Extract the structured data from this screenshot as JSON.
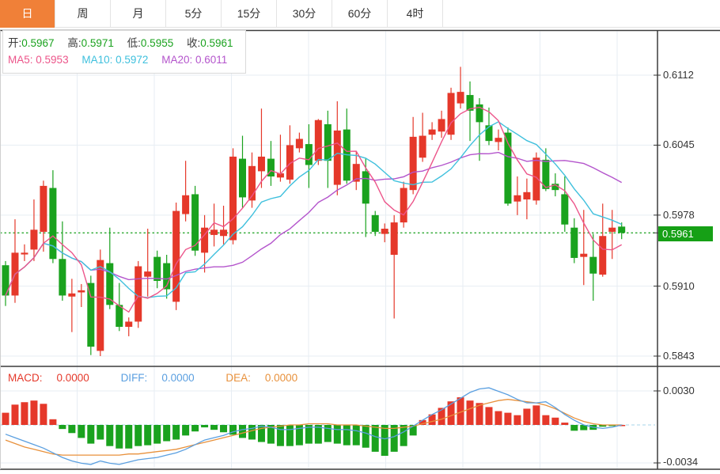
{
  "tabs": {
    "items": [
      {
        "label": "日",
        "active": true
      },
      {
        "label": "周",
        "active": false
      },
      {
        "label": "月",
        "active": false
      },
      {
        "label": "5分",
        "active": false
      },
      {
        "label": "15分",
        "active": false
      },
      {
        "label": "30分",
        "active": false
      },
      {
        "label": "60分",
        "active": false
      },
      {
        "label": "4时",
        "active": false
      }
    ]
  },
  "info_box": {
    "ohlc": [
      {
        "label": "开:",
        "value": "0.5967"
      },
      {
        "label": "高:",
        "value": "0.5971"
      },
      {
        "label": "低:",
        "value": "0.5955"
      },
      {
        "label": "收:",
        "value": "0.5961"
      }
    ],
    "ma": [
      {
        "label": "MA5:",
        "value": "0.5953"
      },
      {
        "label": "MA10:",
        "value": "0.5972"
      },
      {
        "label": "MA20:",
        "value": "0.6011"
      }
    ]
  },
  "macd_header": [
    {
      "label": "MACD:",
      "value": "0.0000"
    },
    {
      "label": "DIFF:",
      "value": "0.0000"
    },
    {
      "label": "DEA:",
      "value": "0.0000"
    }
  ],
  "axis": {
    "main_labels": [
      {
        "text": "0.6112",
        "value": 0.6112
      },
      {
        "text": "0.6045",
        "value": 0.6045
      },
      {
        "text": "0.5978",
        "value": 0.5978
      },
      {
        "text": "0.5910",
        "value": 0.591
      },
      {
        "text": "0.5843",
        "value": 0.5843
      }
    ],
    "current_price": {
      "text": "0.5961",
      "value": 0.5961
    },
    "macd_labels": [
      {
        "text": "0.0030",
        "value": 0.003
      },
      {
        "text": "-0.0034",
        "value": -0.0034
      }
    ]
  },
  "colors": {
    "up": "#e5382a",
    "down": "#1aa21e",
    "ma5": "#ec558a",
    "ma10": "#3fc0dd",
    "ma20": "#b455cc",
    "diff": "#5a9fe0",
    "dea": "#e8913c",
    "value_green": "#1aa21e",
    "label_dark": "#3a3a3a",
    "badge_bg": "#16a016",
    "price_line": "#2aa82e",
    "grid": "#e7edf3",
    "frame": "#3c3c3c",
    "zero_dash": "#a5d5ea",
    "tab_active_bg": "#f08038"
  },
  "chart_data": {
    "type": "candlestick",
    "title": "Daily OHLC chart with MA5/MA10/MA20 overlays and MACD sub-chart",
    "main": {
      "ylabels": [
        0.6112,
        0.6045,
        0.5978,
        0.591,
        0.5843
      ],
      "ylim": [
        0.5835,
        0.6154
      ],
      "current_price": 0.5961,
      "ma_periods": [
        5,
        10,
        20
      ],
      "candles_format": [
        "open",
        "high",
        "low",
        "close"
      ],
      "candles": [
        [
          0.593,
          0.5934,
          0.5891,
          0.5901
        ],
        [
          0.5901,
          0.5974,
          0.5894,
          0.5942
        ],
        [
          0.5941,
          0.595,
          0.5934,
          0.5942
        ],
        [
          0.5945,
          0.5993,
          0.5934,
          0.5964
        ],
        [
          0.5962,
          0.6011,
          0.5943,
          0.6006
        ],
        [
          0.6004,
          0.6021,
          0.5932,
          0.5936
        ],
        [
          0.5936,
          0.5972,
          0.5896,
          0.5901
        ],
        [
          0.59,
          0.5917,
          0.5866,
          0.5903
        ],
        [
          0.5904,
          0.5912,
          0.589,
          0.5906
        ],
        [
          0.5913,
          0.592,
          0.5844,
          0.5852
        ],
        [
          0.5848,
          0.5945,
          0.5843,
          0.5935
        ],
        [
          0.5932,
          0.5966,
          0.5888,
          0.5892
        ],
        [
          0.5892,
          0.5913,
          0.5867,
          0.5871
        ],
        [
          0.5871,
          0.588,
          0.5862,
          0.5876
        ],
        [
          0.5876,
          0.5934,
          0.587,
          0.5929
        ],
        [
          0.5919,
          0.5965,
          0.59,
          0.5924
        ],
        [
          0.5938,
          0.5944,
          0.5908,
          0.5915
        ],
        [
          0.5932,
          0.594,
          0.5898,
          0.5907
        ],
        [
          0.5895,
          0.599,
          0.5887,
          0.5982
        ],
        [
          0.5979,
          0.603,
          0.5972,
          0.5997
        ],
        [
          0.5998,
          0.6006,
          0.5939,
          0.5944
        ],
        [
          0.5942,
          0.5978,
          0.5923,
          0.5966
        ],
        [
          0.5959,
          0.5989,
          0.5948,
          0.5964
        ],
        [
          0.5958,
          0.5987,
          0.595,
          0.5964
        ],
        [
          0.5954,
          0.6042,
          0.595,
          0.6034
        ],
        [
          0.6032,
          0.6054,
          0.5985,
          0.5995
        ],
        [
          0.5992,
          0.6038,
          0.5985,
          0.6025
        ],
        [
          0.602,
          0.608,
          0.6004,
          0.6034
        ],
        [
          0.6032,
          0.6049,
          0.6006,
          0.6015
        ],
        [
          0.6014,
          0.6055,
          0.601,
          0.6018
        ],
        [
          0.6012,
          0.6064,
          0.6008,
          0.6045
        ],
        [
          0.6042,
          0.6057,
          0.6038,
          0.6051
        ],
        [
          0.6046,
          0.6065,
          0.6004,
          0.6026
        ],
        [
          0.603,
          0.607,
          0.6026,
          0.6069
        ],
        [
          0.6065,
          0.6078,
          0.6004,
          0.603
        ],
        [
          0.6007,
          0.6087,
          0.5997,
          0.6059
        ],
        [
          0.606,
          0.608,
          0.6008,
          0.6011
        ],
        [
          0.601,
          0.6039,
          0.6002,
          0.6027
        ],
        [
          0.602,
          0.6032,
          0.5957,
          0.5989
        ],
        [
          0.5978,
          0.5982,
          0.5958,
          0.5962
        ],
        [
          0.596,
          0.597,
          0.5952,
          0.5965
        ],
        [
          0.594,
          0.5978,
          0.5879,
          0.5971
        ],
        [
          0.5971,
          0.601,
          0.5966,
          0.6004
        ],
        [
          0.6002,
          0.6072,
          0.5998,
          0.6053
        ],
        [
          0.6033,
          0.6076,
          0.6029,
          0.6054
        ],
        [
          0.6055,
          0.6067,
          0.605,
          0.606
        ],
        [
          0.6058,
          0.6078,
          0.6052,
          0.607
        ],
        [
          0.6055,
          0.61,
          0.605,
          0.6095
        ],
        [
          0.6085,
          0.612,
          0.608,
          0.6096
        ],
        [
          0.6093,
          0.6106,
          0.6049,
          0.6078
        ],
        [
          0.6084,
          0.609,
          0.603,
          0.6067
        ],
        [
          0.6064,
          0.6081,
          0.6045,
          0.6049
        ],
        [
          0.6048,
          0.606,
          0.604,
          0.6052
        ],
        [
          0.6057,
          0.6062,
          0.5987,
          0.5989
        ],
        [
          0.5991,
          0.6015,
          0.5978,
          0.5997
        ],
        [
          0.5993,
          0.6013,
          0.5974,
          0.6
        ],
        [
          0.5992,
          0.6038,
          0.5988,
          0.6033
        ],
        [
          0.6031,
          0.6042,
          0.6001,
          0.6003
        ],
        [
          0.6008,
          0.6018,
          0.5996,
          0.6002
        ],
        [
          0.5998,
          0.6015,
          0.5962,
          0.5969
        ],
        [
          0.5966,
          0.5975,
          0.5932,
          0.5937
        ],
        [
          0.5938,
          0.5983,
          0.5911,
          0.5941
        ],
        [
          0.5938,
          0.596,
          0.5896,
          0.5922
        ],
        [
          0.5921,
          0.5989,
          0.5919,
          0.5958
        ],
        [
          0.5962,
          0.5983,
          0.5936,
          0.5966
        ],
        [
          0.5967,
          0.5971,
          0.5955,
          0.5961
        ]
      ]
    },
    "macd": {
      "ylabels": [
        0.003,
        -0.0034
      ],
      "hist": [
        0.00105,
        0.00175,
        0.00196,
        0.0021,
        0.00182,
        0.00049,
        -0.00035,
        -0.0007,
        -0.00112,
        -0.00161,
        -0.00126,
        -0.00182,
        -0.00203,
        -0.00203,
        -0.00182,
        -0.00175,
        -0.00161,
        -0.0014,
        -0.00126,
        -0.00091,
        -0.00056,
        -0.00021,
        -0.00042,
        -0.00063,
        -0.00084,
        -0.00112,
        -0.00126,
        -0.00147,
        -0.00161,
        -0.00182,
        -0.00182,
        -0.00175,
        -0.00161,
        -0.00161,
        -0.00147,
        -0.00161,
        -0.00175,
        -0.00175,
        -0.00196,
        -0.00231,
        -0.00266,
        -0.00231,
        -0.00182,
        -0.00091,
        0.00042,
        0.00091,
        0.00147,
        0.00203,
        0.00238,
        0.0021,
        0.00189,
        0.00154,
        0.00119,
        0.00105,
        0.00084,
        0.0014,
        0.00168,
        0.00084,
        0.00063,
        0.0002,
        -0.0005,
        -0.00045,
        -0.00042,
        -0.00015,
        -8e-05,
        0.0
      ],
      "diff": [
        -0.0008,
        -0.0011,
        -0.0014,
        -0.0017,
        -0.002,
        -0.0024,
        -0.0028,
        -0.0031,
        -0.0033,
        -0.0034,
        -0.0031,
        -0.0033,
        -0.0034,
        -0.0032,
        -0.003,
        -0.0029,
        -0.0028,
        -0.0026,
        -0.0024,
        -0.0021,
        -0.0017,
        -0.0013,
        -0.0011,
        -0.0009,
        -0.0006,
        -0.0004,
        -0.0003,
        -0.0001,
        -0.0002,
        -0.0004,
        -0.0004,
        -0.0003,
        -0.0002,
        -0.0002,
        -0.0003,
        -0.0004,
        -0.0004,
        -0.0005,
        -0.0007,
        -0.001,
        -0.0012,
        -0.001,
        -0.0006,
        -0.0001,
        0.0004,
        0.0009,
        0.0013,
        0.0018,
        0.0023,
        0.0028,
        0.0031,
        0.0032,
        0.0029,
        0.0026,
        0.0022,
        0.0019,
        0.0019,
        0.002,
        0.0015,
        0.0009,
        0.0004,
        0.0,
        -0.0002,
        -0.0003,
        -0.0002,
        0.0
      ],
      "dea": [
        -0.0013,
        -0.0016,
        -0.0019,
        -0.0021,
        -0.0023,
        -0.0025,
        -0.0026,
        -0.0026,
        -0.0026,
        -0.0026,
        -0.0026,
        -0.0026,
        -0.0026,
        -0.0025,
        -0.0025,
        -0.0024,
        -0.0023,
        -0.0022,
        -0.0021,
        -0.0019,
        -0.0017,
        -0.0015,
        -0.0013,
        -0.0011,
        -0.0009,
        -0.0007,
        -0.0005,
        -0.0003,
        -0.0002,
        -0.0001,
        0.0,
        0.0,
        0.0001,
        0.0001,
        0.0001,
        0.0,
        0.0,
        0.0,
        -0.0001,
        -0.0002,
        -0.0003,
        -0.0003,
        -0.0002,
        -0.0001,
        0.0001,
        0.0003,
        0.0005,
        0.0008,
        0.0011,
        0.0014,
        0.0017,
        0.0019,
        0.0021,
        0.0022,
        0.0021,
        0.002,
        0.0019,
        0.0017,
        0.0014,
        0.001,
        0.0006,
        0.0003,
        0.0001,
        0.0,
        0.0,
        0.0
      ]
    }
  }
}
